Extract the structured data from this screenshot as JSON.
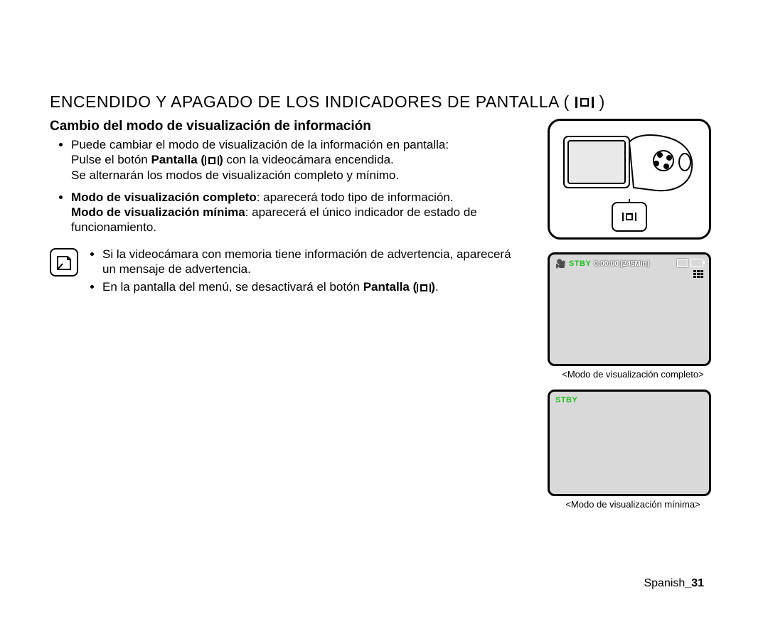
{
  "title": "ENCENDIDO Y APAGADO DE LOS INDICADORES DE PANTALLA (",
  "title_tail": ")",
  "subhead": "Cambio del modo de visualización de información",
  "bullets": [
    {
      "line1": "Puede cambiar el modo de visualización de la información en pantalla:",
      "line2a": "Pulse el botón ",
      "line2b_bold": "Pantalla (",
      "line2c_bold_tail": ")",
      "line2d": " con la videocámara encendida.",
      "line3": "Se alternarán los modos de visualización completo y mínimo."
    },
    {
      "mode1_bold": "Modo de visualización completo",
      "mode1_rest": ": aparecerá todo tipo de información.",
      "mode2_bold": "Modo de visualización mínima",
      "mode2_rest": ": aparecerá el único indicador de estado de funcionamiento."
    }
  ],
  "notes": [
    "Si la videocámara con memoria tiene información de advertencia, aparecerá un mensaje de advertencia.",
    {
      "a": "En la pantalla del menú, se desactivará el botón ",
      "b_bold": "Pantalla (",
      "c_bold_tail": ")",
      "d": "."
    }
  ],
  "lcd_full": {
    "stby": "STBY",
    "time": "0:00:00 [245Min]"
  },
  "lcd_min": {
    "stby": "STBY"
  },
  "caption_full": "<Modo de visualización completo>",
  "caption_min": "<Modo de visualización mínima>",
  "footer_lang": "Spanish",
  "footer_page": "_31"
}
